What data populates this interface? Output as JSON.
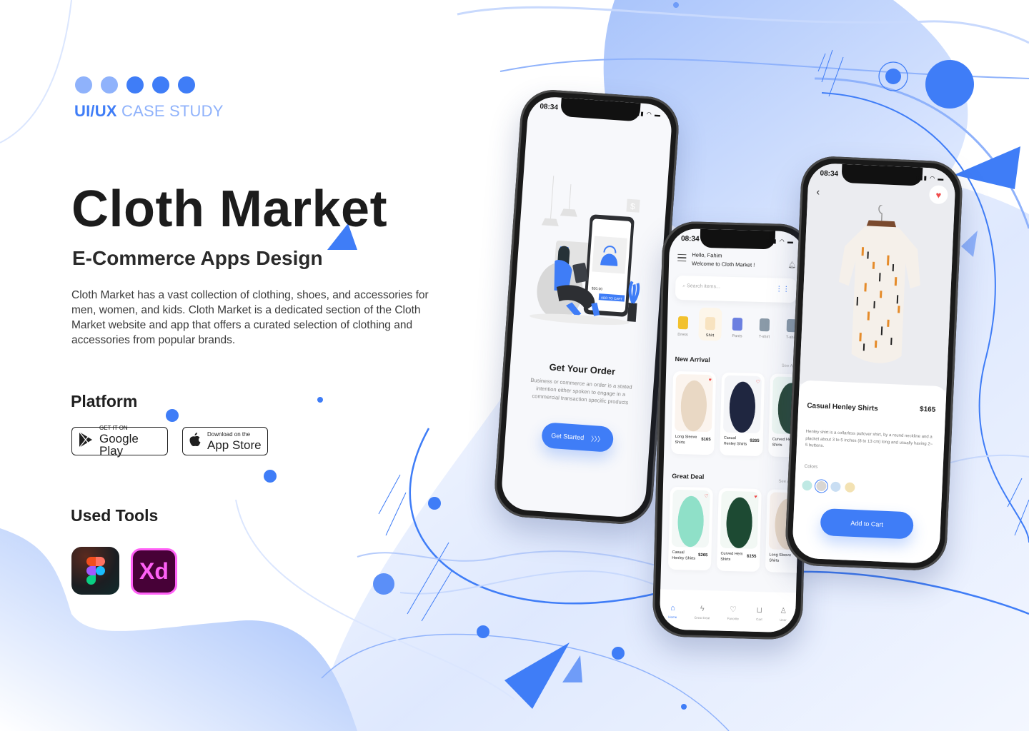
{
  "header": {
    "kicker_strong": "UI/UX",
    "kicker_light": "CASE STUDY",
    "dots": [
      "#8fb2fb",
      "#8fb2fb",
      "#3f7df7",
      "#3f7df7",
      "#3f7df7"
    ]
  },
  "hero": {
    "title": "Cloth Market",
    "subtitle": "E-Commerce Apps Design",
    "description": "Cloth Market has a vast collection of clothing, shoes, and accessories for men, women, and kids. Cloth Market is a dedicated section of the Cloth Market website and app that offers a curated selection of clothing and accessories from popular brands."
  },
  "platform": {
    "heading": "Platform",
    "google_play": {
      "small": "GET IT ON",
      "big": "Google Play",
      "icon": "play-triangle-icon"
    },
    "app_store": {
      "small": "Download on the",
      "big": "App Store",
      "icon": "apple-icon"
    }
  },
  "tools": {
    "heading": "Used Tools",
    "items": [
      {
        "name": "Figma",
        "icon": "figma-icon"
      },
      {
        "name": "Xd",
        "icon": "adobe-xd-icon"
      }
    ]
  },
  "colors": {
    "accent": "#3f7df7",
    "accent_light": "#8fb2fb",
    "heart": "#f04b4b"
  },
  "phone_onboarding": {
    "time": "08:34",
    "status_icons": "▮▮▮ ◠ ▬",
    "illustration_price": "$20.00",
    "illustration_button": "ADD TO CART",
    "title": "Get Your Order",
    "description": "Business or commerce an order is a stated intention either spoken to engage in a commercial transaction specific products",
    "cta_label": "Get Started",
    "cta_icon": "〉〉〉"
  },
  "phone_home": {
    "time": "08:34",
    "status_icons": "▮▮▮ ◠ ▬",
    "greeting": "Hello, Fahim",
    "welcome": "Welcome to Cloth Market !",
    "search_placeholder": "Search items...",
    "categories": [
      {
        "label": "Dress",
        "color": "#f2c12e",
        "active": false
      },
      {
        "label": "Shirt",
        "color": "#f8e3c0",
        "active": true
      },
      {
        "label": "Pants",
        "color": "#6b7fe0",
        "active": false
      },
      {
        "label": "T-shirt",
        "color": "#8a9aa8",
        "active": false
      },
      {
        "label": "T-shirt",
        "color": "#8a9aa8",
        "active": false
      }
    ],
    "new_arrival": {
      "title": "New Arrival",
      "see_all": "See All",
      "items": [
        {
          "name": "Long Sleeve Shirts",
          "price": "$165",
          "fav": true,
          "bg": "#fbf4ee",
          "color": "#e9d8c4"
        },
        {
          "name": "Casual Henley Shirts",
          "price": "$265",
          "fav": false,
          "bg": "#f4f5f8",
          "color": "#1f2640"
        },
        {
          "name": "Curved Hem Shirts",
          "price": "",
          "fav": false,
          "bg": "#eef8f3",
          "color": "#2b4a3a"
        }
      ]
    },
    "great_deal": {
      "title": "Great Deal",
      "see_all": "See All",
      "items": [
        {
          "name": "Casual Henley Shirts",
          "price": "$265",
          "fav": false,
          "bg": "#f3f8f6",
          "color": "#8fe0c8"
        },
        {
          "name": "Curved Hem Shirts",
          "price": "$155",
          "fav": true,
          "bg": "#f2f8f4",
          "color": "#1d4a33"
        },
        {
          "name": "Long Sleeve Shirts",
          "price": "",
          "fav": false,
          "bg": "#fbf4ee",
          "color": "#e9d8c4"
        }
      ]
    },
    "tabs": [
      {
        "label": "Home",
        "icon": "⌂",
        "active": true
      },
      {
        "label": "Great Deal",
        "icon": "ϟ",
        "active": false
      },
      {
        "label": "Favorite",
        "icon": "♡",
        "active": false
      },
      {
        "label": "Cart",
        "icon": "🛒",
        "active": false
      },
      {
        "label": "User",
        "icon": "♙",
        "active": false
      }
    ]
  },
  "phone_detail": {
    "time": "08:34",
    "status_icons": "▮▮▮ ◠ ▬",
    "back_icon": "‹",
    "fav_icon": "♥",
    "name": "Casual Henley Shirts",
    "price": "$165",
    "description": "Henley shirt is a collarless pullover shirt, by a round neckline and a placket about 3 to 5 inches (8 to 13 cm) long and usually having 2–5 buttons.",
    "colors_label": "Colors",
    "swatches": [
      {
        "color": "#bfe9e4",
        "selected": false
      },
      {
        "color": "#d9d6d3",
        "selected": true
      },
      {
        "color": "#c9def3",
        "selected": false
      },
      {
        "color": "#f3e2b3",
        "selected": false
      }
    ],
    "cta_label": "Add to Cart"
  }
}
